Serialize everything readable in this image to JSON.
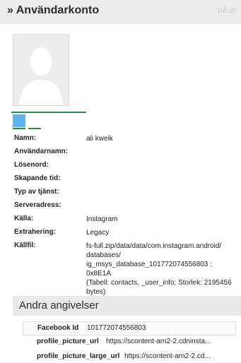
{
  "header": {
    "title": "» Användarkonto",
    "goto_label": "Gå till"
  },
  "icons": {
    "avatar": "user-silhouette-icon"
  },
  "fields": [
    {
      "label": "Namn:",
      "value": "ali kweik"
    },
    {
      "label": "Användarnamn:",
      "value": ""
    },
    {
      "label": "Lösenord:",
      "value": ""
    },
    {
      "label": "Skapande tid:",
      "value": ""
    },
    {
      "label": "Typ av tjänst:",
      "value": ""
    },
    {
      "label": "Serveradress:",
      "value": ""
    },
    {
      "label": "Källa:",
      "value": "Instagram"
    },
    {
      "label": "Extrahering:",
      "value": "Legacy"
    },
    {
      "label": "Källfil:",
      "value_lines": [
        "fs-full.zip/data/data/com.instagram.android/",
        "databases/",
        "ig_msys_database_101772074556803 : 0x8E1A",
        "(Tabell: contacts, _user_info; Storlek: 2195456",
        "bytes)"
      ]
    }
  ],
  "section": {
    "title": "Andra angivelser"
  },
  "extra": [
    {
      "key": "Facebook Id",
      "value": "101772074556803"
    },
    {
      "key": "profile_picture_url",
      "value": "https://scontent-arn2-2.cdninsta..."
    },
    {
      "key": "profile_picture_large_url",
      "value": "https://scontent-arn2-2.cd..."
    }
  ],
  "colors": {
    "accent_green": "#2e8b3a",
    "badge_blue": "#5eb4e8",
    "header_bg": "#ececec"
  }
}
